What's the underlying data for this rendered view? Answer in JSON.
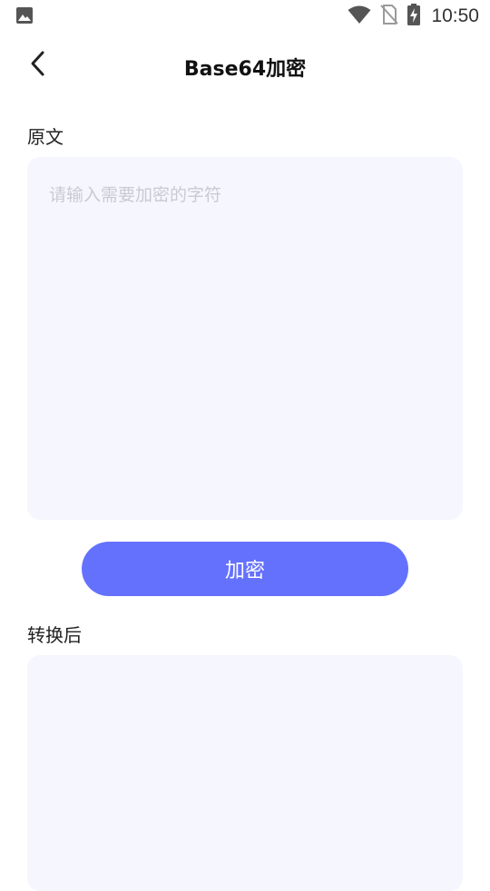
{
  "status_bar": {
    "time": "10:50",
    "icons": [
      "image-icon",
      "wifi-icon",
      "no-sim-icon",
      "battery-charging-icon"
    ]
  },
  "header": {
    "title": "Base64加密",
    "back_icon": "chevron-left-icon"
  },
  "source": {
    "label": "原文",
    "placeholder": "请输入需要加密的字符",
    "value": ""
  },
  "encrypt_button": {
    "label": "加密"
  },
  "result": {
    "label": "转换后",
    "value": ""
  },
  "colors": {
    "accent": "#6471fd",
    "box_background": "#f6f7fe",
    "placeholder": "#c9cad2"
  }
}
